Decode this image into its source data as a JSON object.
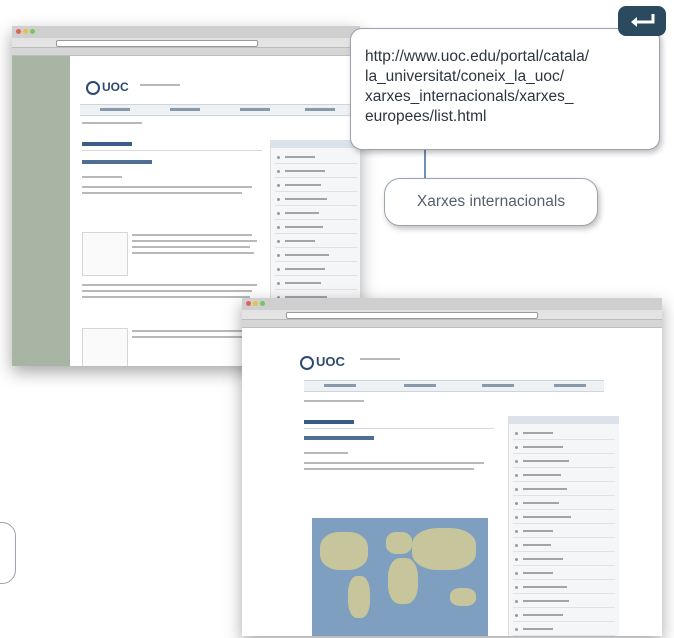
{
  "callout": {
    "url_text": "http://www.uoc.edu/portal/catala/\nla_universitat/coneix_la_uoc/\nxarxes_internacionals/xarxes_\neuropees/list.html"
  },
  "pill": {
    "label": "Xarxes internacionals"
  },
  "return_button": {
    "icon": "return-arrow-icon"
  },
  "screenshots": {
    "first": {
      "logo_text": "UOC"
    },
    "second": {
      "logo_text": "UOC"
    }
  },
  "colors": {
    "return_button_bg": "#2b4a5f",
    "callout_border": "#9aa3ad",
    "uoc_blue": "#2d4a6e"
  }
}
